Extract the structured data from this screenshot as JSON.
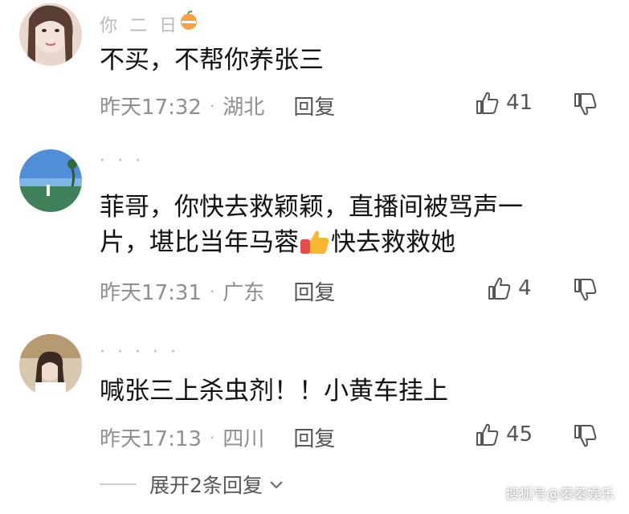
{
  "comments": [
    {
      "username": "你 二 日",
      "text": "不买，不帮你养张三",
      "time": "昨天17:32",
      "location": "湖北",
      "reply_label": "回复",
      "likes": "41"
    },
    {
      "username": "· · ·",
      "text_line1": "菲哥，你快去救颖颖，直播间被骂声一",
      "text_line2a": "片，堪比当年马蓉",
      "text_line2b": "快去救救她",
      "time": "昨天17:31",
      "location": "广东",
      "reply_label": "回复",
      "likes": "4"
    },
    {
      "username": "· · ·  · ·",
      "text": "喊张三上杀虫剂！！小黄车挂上",
      "time": "昨天17:13",
      "location": "四川",
      "reply_label": "回复",
      "likes": "45"
    }
  ],
  "expand_replies": "展开2条回复",
  "watermark": "搜狐号@蓁蓁娱乐",
  "icons": {
    "like": "thumbs-up-icon",
    "dislike": "thumbs-down-icon",
    "expand": "chevron-down-icon",
    "badge": "orange-badge-icon",
    "emoji": "thumbs-up-emoji"
  }
}
